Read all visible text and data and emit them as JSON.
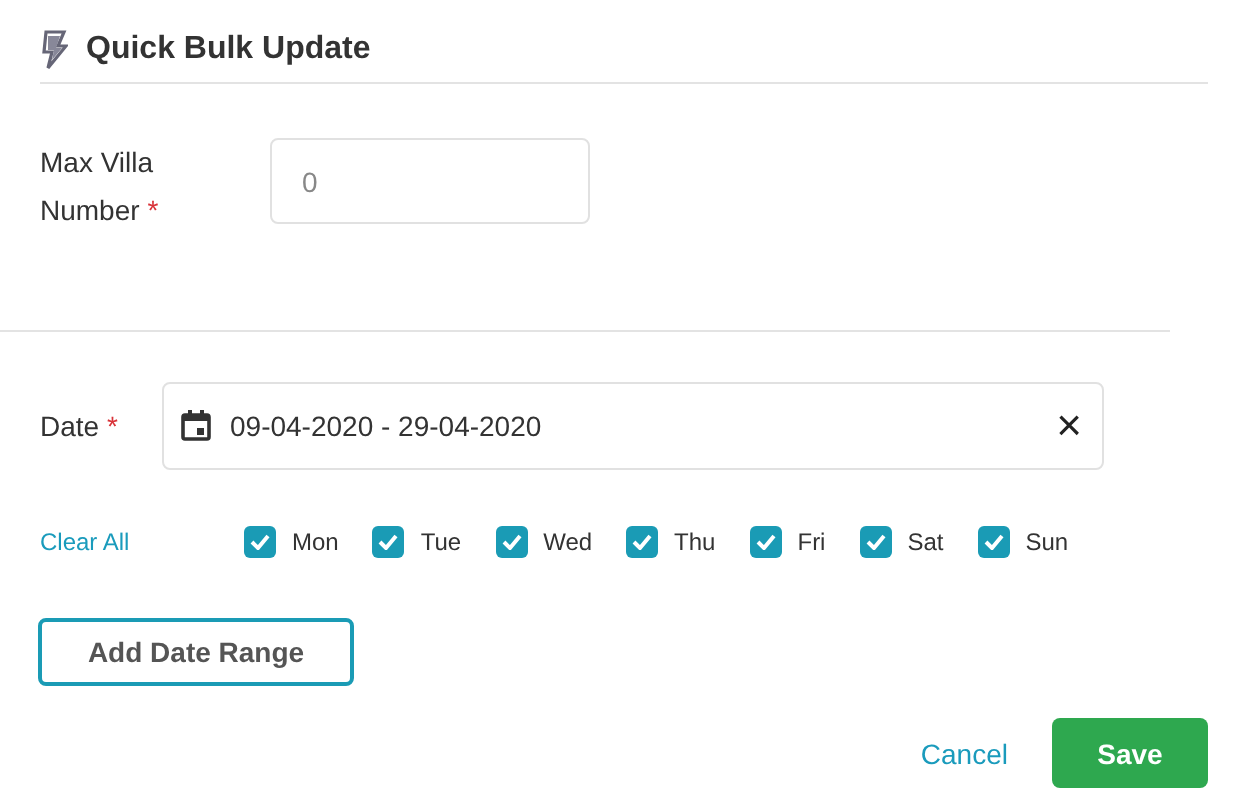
{
  "header": {
    "title": "Quick Bulk Update"
  },
  "max_villa": {
    "label": "Max Villa Number",
    "required_mark": "*",
    "placeholder": "0"
  },
  "date": {
    "label": "Date",
    "required_mark": "*",
    "value": "09-04-2020 - 29-04-2020",
    "clear": "×"
  },
  "clear_all": "Clear All",
  "days": [
    {
      "label": "Mon",
      "checked": true
    },
    {
      "label": "Tue",
      "checked": true
    },
    {
      "label": "Wed",
      "checked": true
    },
    {
      "label": "Thu",
      "checked": true
    },
    {
      "label": "Fri",
      "checked": true
    },
    {
      "label": "Sat",
      "checked": true
    },
    {
      "label": "Sun",
      "checked": true
    }
  ],
  "add_range": "Add Date Range",
  "buttons": {
    "cancel": "Cancel",
    "save": "Save"
  }
}
